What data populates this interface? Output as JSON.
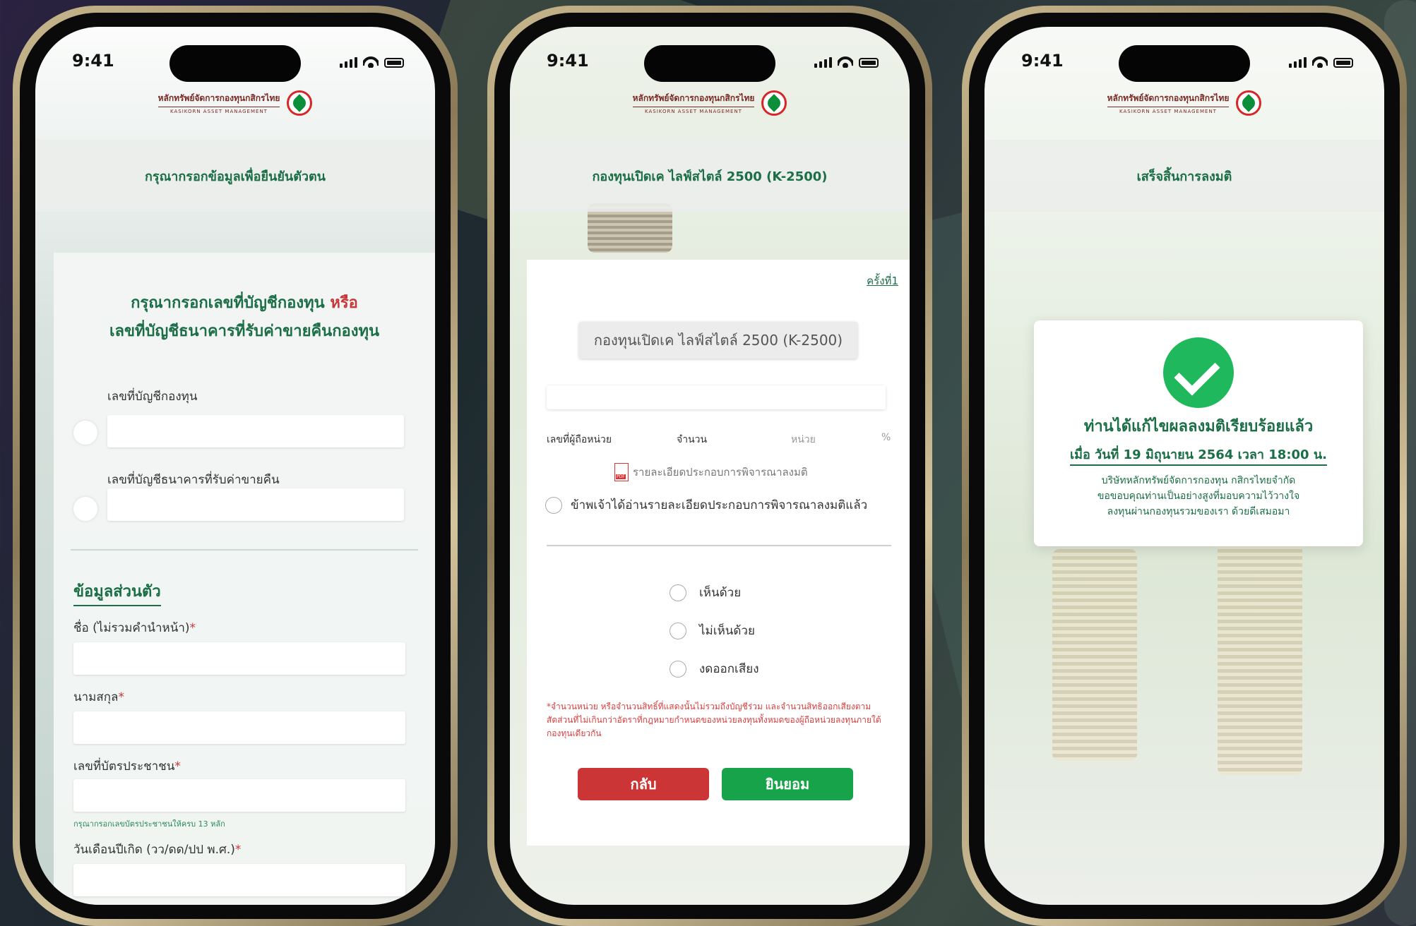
{
  "status": {
    "time": "9:41"
  },
  "brand": {
    "name_th": "หลักทรัพย์จัดการกองทุนกสิกรไทย",
    "name_en": "KASIKORN ASSET MANAGEMENT"
  },
  "screen1": {
    "title": "กรุณากรอกข้อมูลเพื่อยืนยันตัวตน",
    "heading_line1": "กรุณากรอกเลขที่บัญชีกองทุน",
    "heading_or": "หรือ",
    "heading_line2": "เลขที่บัญชีธนาคารที่รับค่าขายคืนกองทุน",
    "option_fund_account": "เลขที่บัญชีกองทุน",
    "option_bank_account": "เลขที่บัญชีธนาคารที่รับค่าขายคืน",
    "section_personal": "ข้อมูลส่วนตัว",
    "label_first_name": "ชื่อ (ไม่รวมคำนำหน้า)",
    "label_last_name": "นามสกุล",
    "label_id_card": "เลขที่บัตรประชาชน",
    "hint_id_card": "กรุณากรอกเลขบัตรประชาชนให้ครบ 13 หลัก",
    "label_birthdate": "วันเดือนปีเกิด (วว/ดด/ปป พ.ศ.)",
    "required_mark": "*"
  },
  "screen2": {
    "title": "กองทุนเปิดเค ไลฟ์สไตล์ 2500 (K-2500)",
    "round": "ครั้งที่1",
    "fund_button": "กองทุนเปิดเค ไลฟ์สไตล์ 2500 (K-2500)",
    "col_holder": "เลขที่ผู้ถือหน่วย",
    "col_amount": "จำนวน",
    "col_unit": "หน่วย",
    "col_percent": "%",
    "pdf_link": "รายละเอียดประกอบการพิจารณาลงมติ",
    "acknowledge": "ข้าพเจ้าได้อ่านรายละเอียดประกอบการพิจารณาลงมติแล้ว",
    "vote_agree": "เห็นด้วย",
    "vote_disagree": "ไม่เห็นด้วย",
    "vote_abstain": "งดออกเสียง",
    "note": "*จำนวนหน่วย หรือจำนวนสิทธิ์ที่แสดงนั้นไม่รวมถึงบัญชีร่วม และจำนวนสิทธิออกเสียงตามสัดส่วนที่ไม่เกินกว่าอัตราที่กฎหมายกำหนดของหน่วยลงทุนทั้งหมดของผู้ถือหน่วยลงทุนภายใต้กองทุนเดียวกัน",
    "button_back": "กลับ",
    "button_confirm": "ยินยอม"
  },
  "screen3": {
    "title": "เสร็จสิ้นการลงมติ",
    "done_message": "ท่านได้แก้ไขผลลงมติเรียบร้อยแล้ว",
    "timestamp": "เมื่อ วันที่ 19 มิถุนายน 2564   เวลา   18:00 น.",
    "thanks_line1": "บริษัทหลักทรัพย์จัดการกองทุน กสิกรไทยจำกัด",
    "thanks_line2": "ขอขอบคุณท่านเป็นอย่างสูงที่มอบความไว้วางใจ",
    "thanks_line3": "ลงทุนผ่านกองทุนรวมของเรา ด้วยดีเสมอมา"
  },
  "colors": {
    "primary_green": "#1b6e46",
    "accent_red": "#c8373a",
    "confirm_green": "#16a34a",
    "back_red": "#cc3535"
  }
}
